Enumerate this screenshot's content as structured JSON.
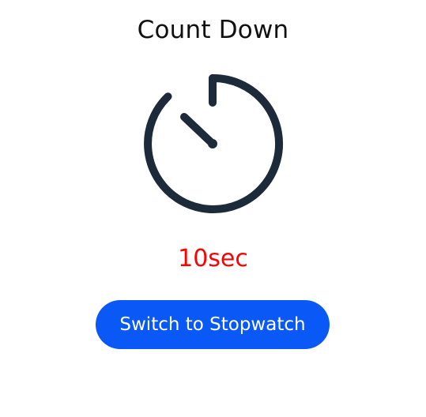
{
  "header": {
    "title": "Count Down"
  },
  "timer": {
    "icon": "timer-icon",
    "icon_color": "#1c2a3a",
    "readout": "10sec",
    "readout_color": "#ff0000"
  },
  "actions": {
    "switch_label": "Switch to Stopwatch",
    "accent_color": "#0a59f7"
  }
}
